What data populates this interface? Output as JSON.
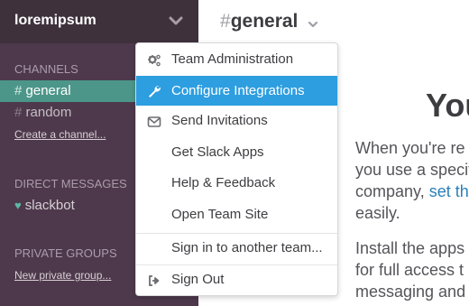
{
  "sidebar": {
    "team_name": "loremipsum",
    "channels_title": "CHANNELS",
    "channels": [
      {
        "hash": "#",
        "name": "general"
      },
      {
        "hash": "#",
        "name": "random"
      }
    ],
    "create_channel": "Create a channel...",
    "dm_title": "DIRECT MESSAGES",
    "dm_user": "slackbot",
    "private_title": "PRIVATE GROUPS",
    "new_private": "New private group..."
  },
  "header": {
    "hash": "#",
    "channel": "general"
  },
  "main": {
    "welcome": "You",
    "para1": [
      "When you're re",
      "you use a specif",
      "company, ",
      "set th",
      "easily."
    ],
    "para2": [
      "Install the apps",
      "for full access t",
      "messaging and"
    ]
  },
  "menu": {
    "team_admin": "Team Administration",
    "configure": "Configure Integrations",
    "invitations": "Send Invitations",
    "apps": "Get Slack Apps",
    "help": "Help & Feedback",
    "open_site": "Open Team Site",
    "sign_in_other": "Sign in to another team...",
    "sign_out": "Sign Out"
  },
  "colors": {
    "sidebar_bg": "#4d394b",
    "active_channel": "#4c9689",
    "menu_highlight": "#2d9ee0",
    "link": "#2a80b9"
  }
}
